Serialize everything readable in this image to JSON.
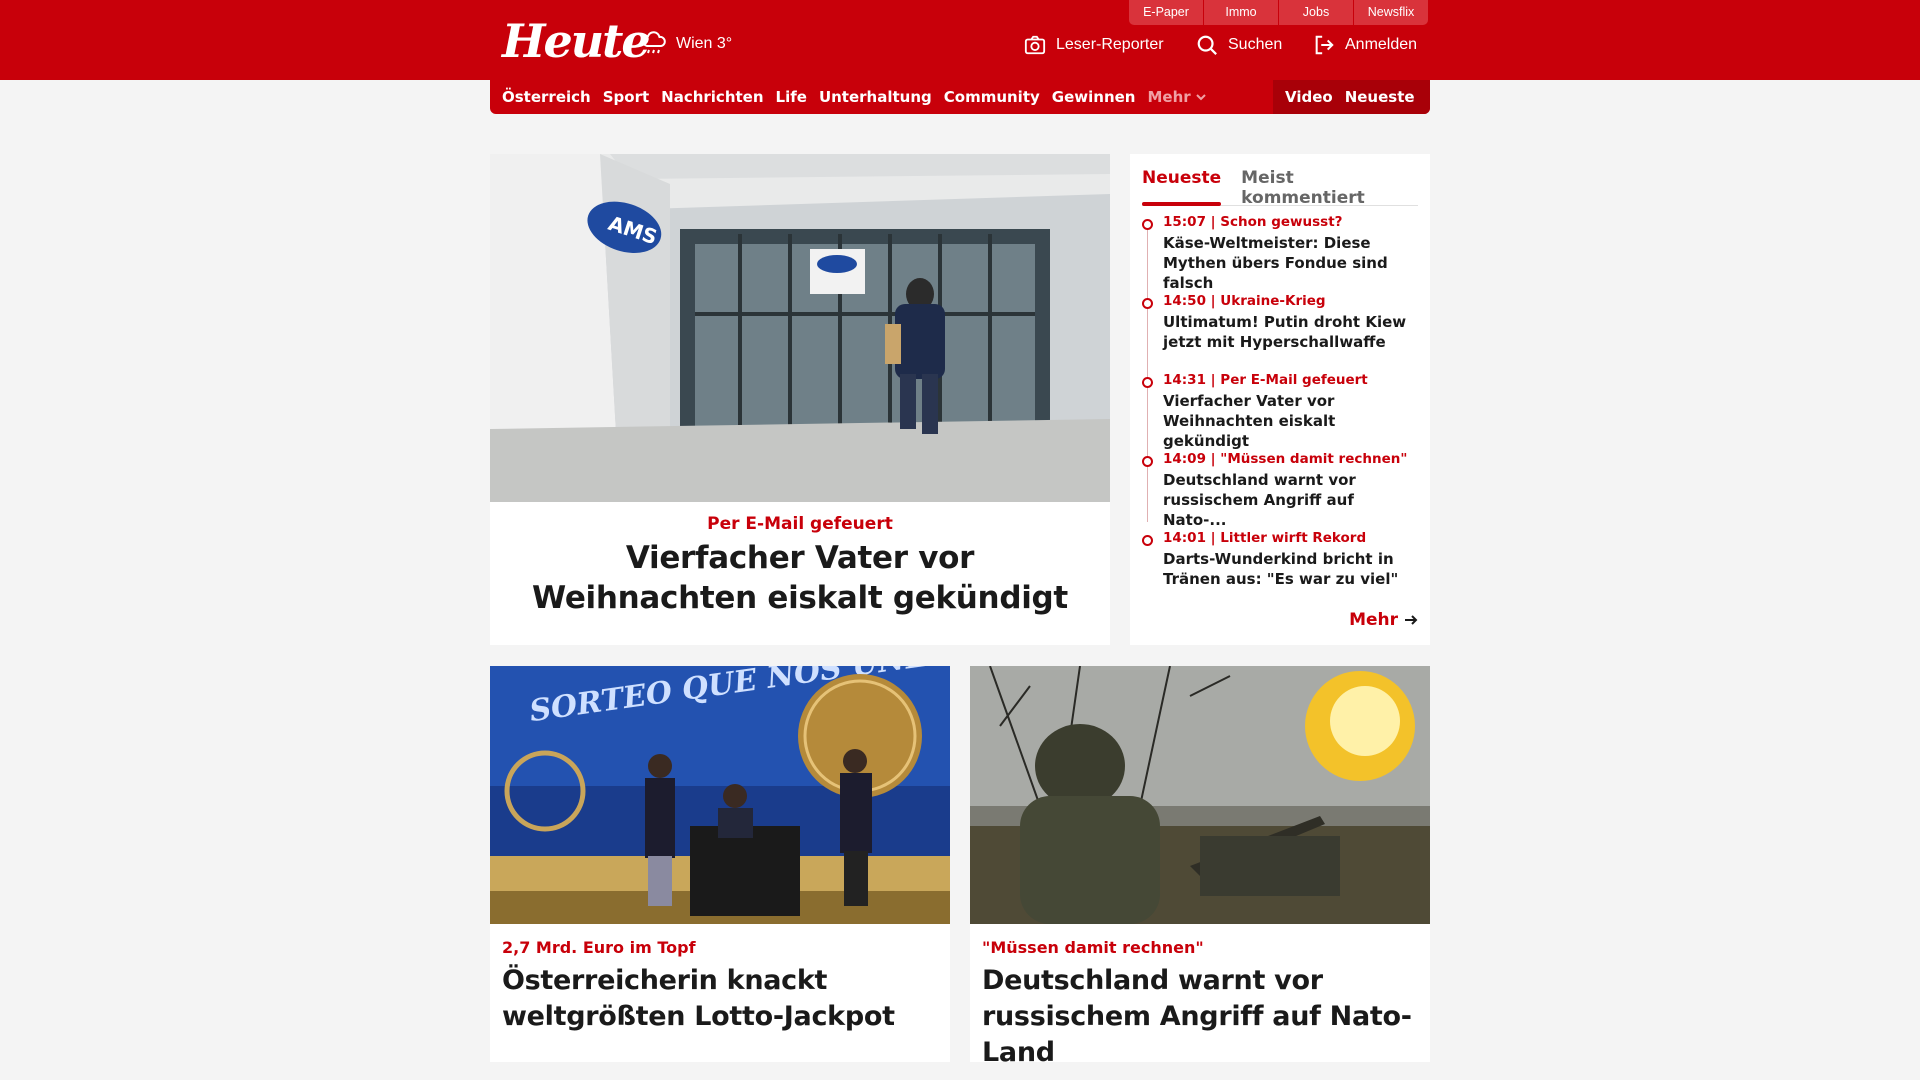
{
  "brand": {
    "logo": "Heute",
    "accent": "#c8000a"
  },
  "header": {
    "weather": "Wien 3°",
    "service_tabs": [
      "E-Paper",
      "Immo",
      "Jobs",
      "Newsflix"
    ],
    "reporter": "Leser-Reporter",
    "search": "Suchen",
    "login": "Anmelden"
  },
  "nav": {
    "items": [
      "Österreich",
      "Sport",
      "Nachrichten",
      "Life",
      "Unterhaltung",
      "Community",
      "Gewinnen"
    ],
    "more": "Mehr",
    "right": [
      "Video",
      "Neueste"
    ]
  },
  "lead": {
    "kicker": "Per E-Mail gefeuert",
    "headline": "Vierfacher Vater vor Weihnachten eiskalt gekündigt",
    "image_sign": "AMS"
  },
  "sidebar": {
    "tabs": [
      "Neueste",
      "Meist kommentiert"
    ],
    "items": [
      {
        "meta": "15:07 | Schon gewusst?",
        "title": "Käse-Weltmeister: Diese Mythen übers Fondue sind falsch"
      },
      {
        "meta": "14:50 | Ukraine-Krieg",
        "title": "Ultimatum! Putin droht Kiew jetzt mit Hyperschallwaffe"
      },
      {
        "meta": "14:31 | Per E-Mail gefeuert",
        "title": "Vierfacher Vater vor Weihnachten eiskalt gekündigt"
      },
      {
        "meta": "14:09 | \"Müssen damit rechnen\"",
        "title": "Deutschland warnt vor russischem Angriff auf Nato-..."
      },
      {
        "meta": "14:01 | Littler wirft Rekord",
        "title": "Darts-Wunderkind bricht in Tränen aus: \"Es war zu viel\""
      }
    ],
    "more": "Mehr"
  },
  "cards": [
    {
      "kicker": "2,7 Mrd. Euro im Topf",
      "headline": "Österreicherin knackt weltgrößten Lotto-Jackpot",
      "image_text": "SORTEO QUE NOS UNE"
    },
    {
      "kicker": "\"Müssen damit rechnen\"",
      "headline": "Deutschland warnt vor russischem Angriff auf Nato-Land"
    }
  ]
}
